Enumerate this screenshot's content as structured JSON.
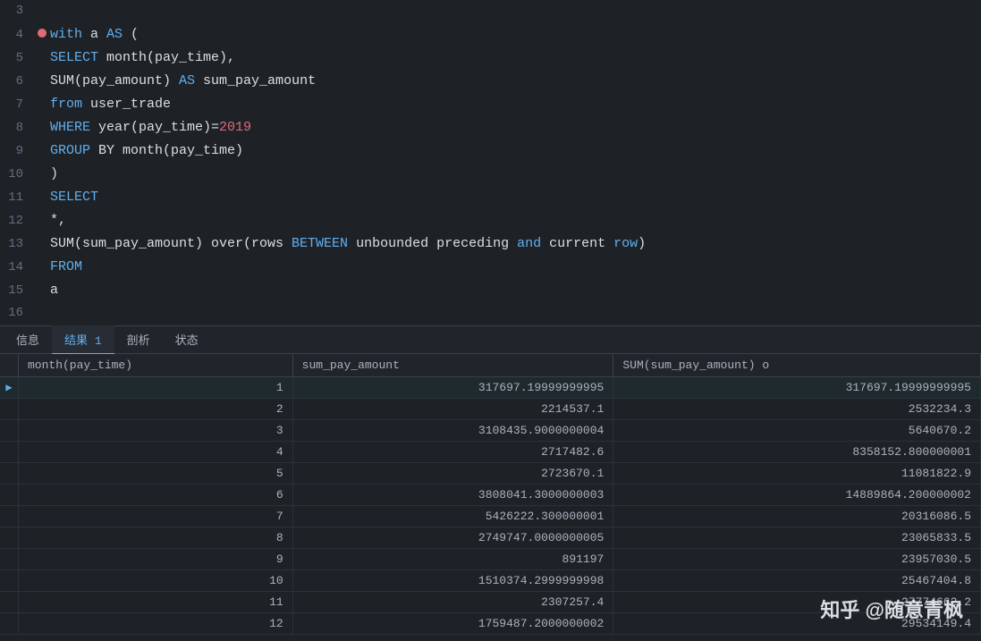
{
  "editor": {
    "lines": [
      {
        "num": "3",
        "hasBp": false,
        "content": []
      },
      {
        "num": "4",
        "hasBp": true,
        "content": [
          {
            "t": "with",
            "c": "kw-blue"
          },
          {
            "t": " a ",
            "c": "kw-white"
          },
          {
            "t": "AS",
            "c": "kw-blue"
          },
          {
            "t": " (",
            "c": "kw-white"
          }
        ]
      },
      {
        "num": "5",
        "hasBp": false,
        "content": [
          {
            "t": "SELECT",
            "c": "kw-blue"
          },
          {
            "t": " month(pay_time),",
            "c": "kw-white"
          }
        ]
      },
      {
        "num": "6",
        "hasBp": false,
        "content": [
          {
            "t": "SUM(pay_amount)",
            "c": "kw-white"
          },
          {
            "t": " AS",
            "c": "kw-blue"
          },
          {
            "t": " sum_pay_amount",
            "c": "kw-white"
          }
        ]
      },
      {
        "num": "7",
        "hasBp": false,
        "content": [
          {
            "t": "from",
            "c": "kw-blue"
          },
          {
            "t": " user_trade",
            "c": "kw-white"
          }
        ]
      },
      {
        "num": "8",
        "hasBp": false,
        "content": [
          {
            "t": "WHERE",
            "c": "kw-blue"
          },
          {
            "t": " year(pay_time)=",
            "c": "kw-white"
          },
          {
            "t": "2019",
            "c": "kw-red"
          }
        ]
      },
      {
        "num": "9",
        "hasBp": false,
        "content": [
          {
            "t": "GROUP",
            "c": "kw-blue"
          },
          {
            "t": " BY month(pay_time)",
            "c": "kw-white"
          }
        ]
      },
      {
        "num": "10",
        "hasBp": false,
        "content": [
          {
            "t": ")",
            "c": "kw-white"
          }
        ]
      },
      {
        "num": "11",
        "hasBp": false,
        "content": [
          {
            "t": "SELECT",
            "c": "kw-blue"
          }
        ]
      },
      {
        "num": "12",
        "hasBp": false,
        "content": [
          {
            "t": "*,",
            "c": "kw-white"
          }
        ]
      },
      {
        "num": "13",
        "hasBp": false,
        "content": [
          {
            "t": "SUM(sum_pay_amount) over(rows ",
            "c": "kw-white"
          },
          {
            "t": "BETWEEN",
            "c": "kw-blue"
          },
          {
            "t": " unbounded preceding ",
            "c": "kw-white"
          },
          {
            "t": "and",
            "c": "kw-blue"
          },
          {
            "t": " current ",
            "c": "kw-white"
          },
          {
            "t": "row",
            "c": "kw-blue"
          },
          {
            "t": ")",
            "c": "kw-white"
          }
        ]
      },
      {
        "num": "14",
        "hasBp": false,
        "content": [
          {
            "t": "FROM",
            "c": "kw-blue"
          }
        ]
      },
      {
        "num": "15",
        "hasBp": false,
        "content": [
          {
            "t": "a",
            "c": "kw-white"
          }
        ]
      },
      {
        "num": "16",
        "hasBp": false,
        "content": []
      }
    ]
  },
  "tabs": [
    {
      "label": "信息",
      "active": false
    },
    {
      "label": "结果 1",
      "active": true
    },
    {
      "label": "剖析",
      "active": false
    },
    {
      "label": "状态",
      "active": false
    }
  ],
  "table": {
    "headers": [
      "month(pay_time)",
      "sum_pay_amount",
      "SUM(sum_pay_amount) o"
    ],
    "rows": [
      {
        "indicator": true,
        "col1": "1",
        "col2": "317697.19999999995",
        "col3": "317697.19999999995"
      },
      {
        "indicator": false,
        "col1": "2",
        "col2": "2214537.1",
        "col3": "2532234.3"
      },
      {
        "indicator": false,
        "col1": "3",
        "col2": "3108435.9000000004",
        "col3": "5640670.2"
      },
      {
        "indicator": false,
        "col1": "4",
        "col2": "2717482.6",
        "col3": "8358152.800000001"
      },
      {
        "indicator": false,
        "col1": "5",
        "col2": "2723670.1",
        "col3": "11081822.9"
      },
      {
        "indicator": false,
        "col1": "6",
        "col2": "3808041.3000000003",
        "col3": "14889864.200000002"
      },
      {
        "indicator": false,
        "col1": "7",
        "col2": "5426222.300000001",
        "col3": "20316086.5"
      },
      {
        "indicator": false,
        "col1": "8",
        "col2": "2749747.0000000005",
        "col3": "23065833.5"
      },
      {
        "indicator": false,
        "col1": "9",
        "col2": "891197",
        "col3": "23957030.5"
      },
      {
        "indicator": false,
        "col1": "10",
        "col2": "1510374.2999999998",
        "col3": "25467404.8"
      },
      {
        "indicator": false,
        "col1": "11",
        "col2": "2307257.4",
        "col3": "27774662.2"
      },
      {
        "indicator": false,
        "col1": "12",
        "col2": "1759487.2000000002",
        "col3": "29534149.4"
      }
    ]
  },
  "watermark": "知乎 @随意青枫"
}
